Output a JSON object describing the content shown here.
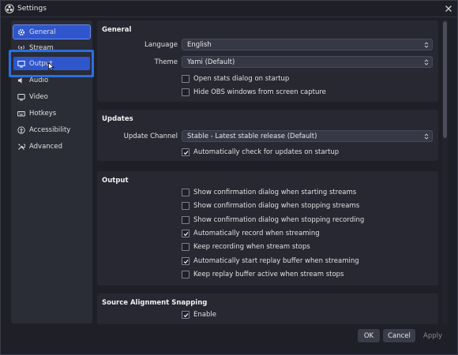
{
  "window": {
    "title": "Settings",
    "close_icon": "close-icon"
  },
  "sidebar": {
    "items": [
      {
        "label": "General",
        "icon": "gear-icon",
        "selected": true
      },
      {
        "label": "Stream",
        "icon": "antenna-icon"
      },
      {
        "label": "Output",
        "icon": "monitor-icon",
        "hovered": true
      },
      {
        "label": "Audio",
        "icon": "speaker-icon"
      },
      {
        "label": "Video",
        "icon": "video-screen-icon"
      },
      {
        "label": "Hotkeys",
        "icon": "keyboard-icon"
      },
      {
        "label": "Accessibility",
        "icon": "accessibility-icon"
      },
      {
        "label": "Advanced",
        "icon": "tools-icon"
      }
    ]
  },
  "general": {
    "title": "General",
    "language_label": "Language",
    "language_value": "English",
    "theme_label": "Theme",
    "theme_value": "Yami (Default)",
    "checks": [
      {
        "label": "Open stats dialog on startup",
        "checked": false
      },
      {
        "label": "Hide OBS windows from screen capture",
        "checked": false
      }
    ]
  },
  "updates": {
    "title": "Updates",
    "channel_label": "Update Channel",
    "channel_value": "Stable - Latest stable release (Default)",
    "checks": [
      {
        "label": "Automatically check for updates on startup",
        "checked": true
      }
    ]
  },
  "output": {
    "title": "Output",
    "checks": [
      {
        "label": "Show confirmation dialog when starting streams",
        "checked": false
      },
      {
        "label": "Show confirmation dialog when stopping streams",
        "checked": false
      },
      {
        "label": "Show confirmation dialog when stopping recording",
        "checked": false
      },
      {
        "label": "Automatically record when streaming",
        "checked": true
      },
      {
        "label": "Keep recording when stream stops",
        "checked": false
      },
      {
        "label": "Automatically start replay buffer when streaming",
        "checked": true
      },
      {
        "label": "Keep replay buffer active when stream stops",
        "checked": false
      }
    ]
  },
  "snapping": {
    "title": "Source Alignment Snapping",
    "checks": [
      {
        "label": "Enable",
        "checked": true
      }
    ]
  },
  "footer": {
    "ok_label": "OK",
    "cancel_label": "Cancel",
    "apply_label": "Apply"
  },
  "colors": {
    "accent": "#2f56cc",
    "highlight": "#2a6fe0",
    "background": "#1e1f27"
  }
}
